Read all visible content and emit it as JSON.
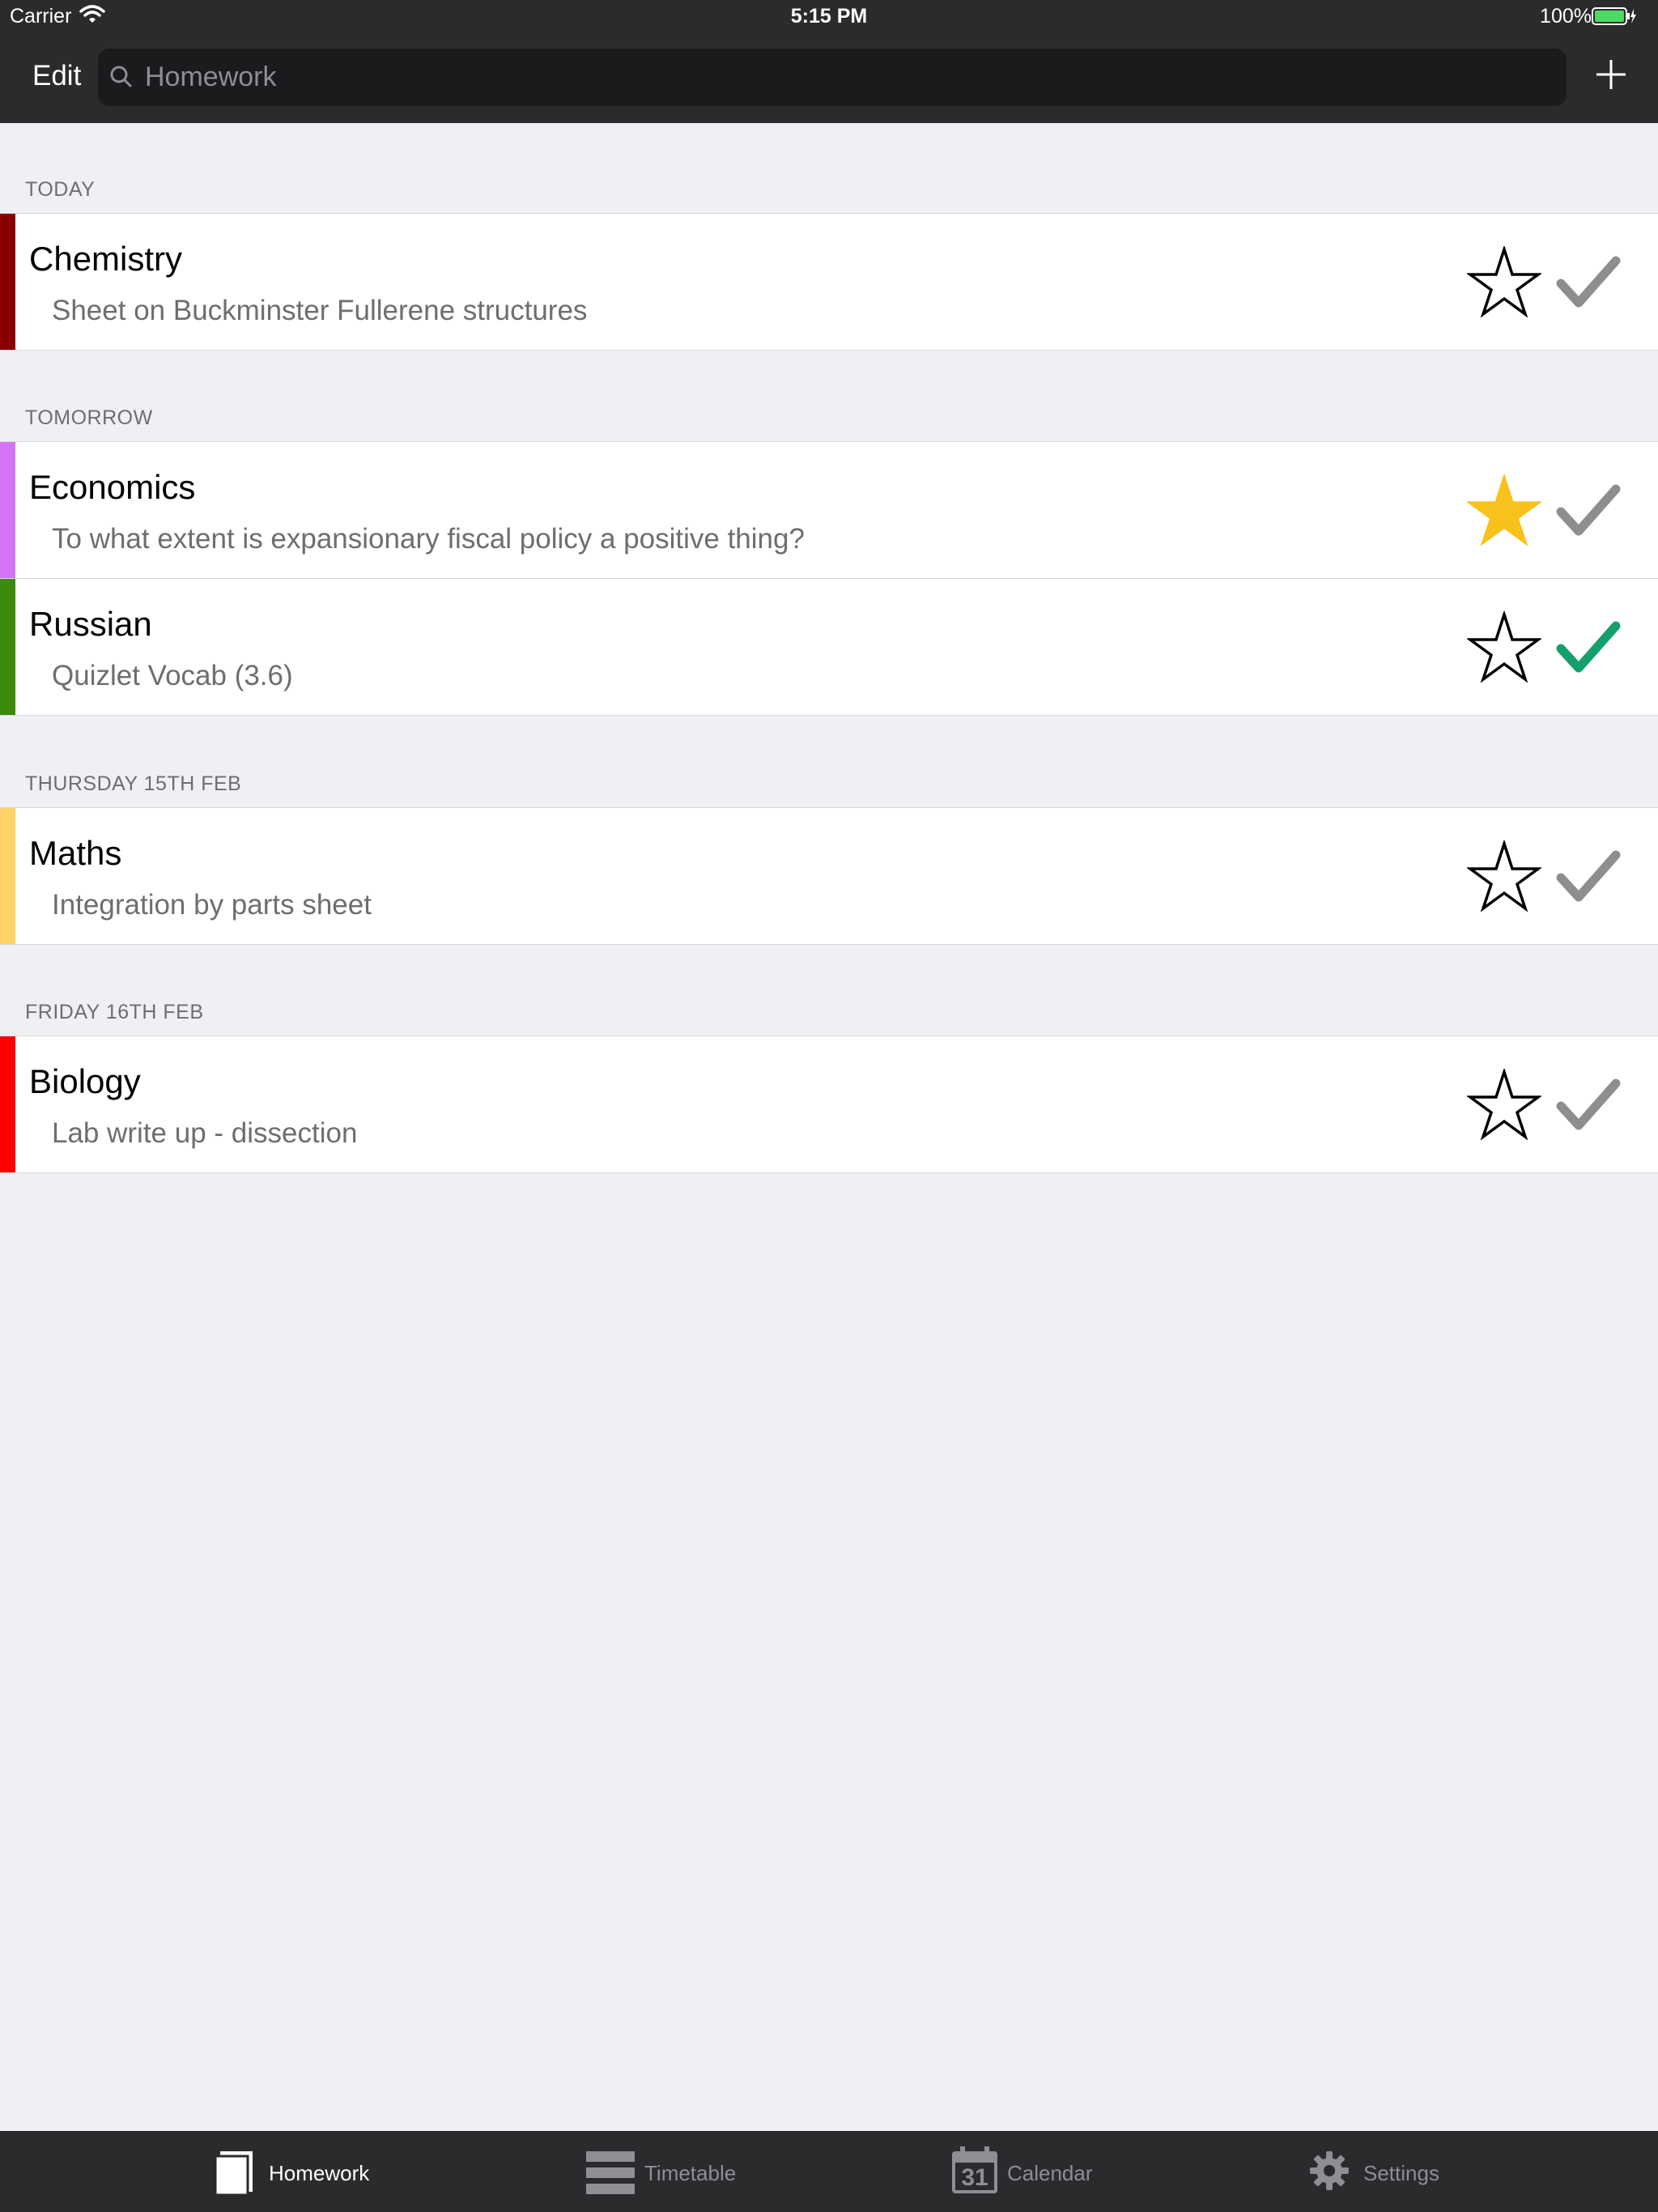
{
  "status_bar": {
    "carrier": "Carrier",
    "time": "5:15 PM",
    "battery": "100%"
  },
  "nav": {
    "edit_label": "Edit",
    "search_placeholder": "Homework"
  },
  "sections": [
    {
      "title": "TODAY",
      "items": [
        {
          "subject": "Chemistry",
          "description": "Sheet on Buckminster Fullerene structures",
          "color": "#8a0000",
          "starred": false,
          "done": false
        }
      ]
    },
    {
      "title": "TOMORROW",
      "items": [
        {
          "subject": "Economics",
          "description": "To what extent is expansionary fiscal policy a positive thing?",
          "color": "#d473f5",
          "starred": true,
          "done": false
        },
        {
          "subject": "Russian",
          "description": "Quizlet Vocab (3.6)",
          "color": "#3d8a0b",
          "starred": false,
          "done": true
        }
      ]
    },
    {
      "title": "THURSDAY 15TH FEB",
      "items": [
        {
          "subject": "Maths",
          "description": "Integration by parts sheet",
          "color": "#ffd266",
          "starred": false,
          "done": false
        }
      ]
    },
    {
      "title": "FRIDAY 16TH FEB",
      "items": [
        {
          "subject": "Biology",
          "description": "Lab write up - dissection",
          "color": "#ff0000",
          "starred": false,
          "done": false
        }
      ]
    }
  ],
  "tabs": [
    {
      "label": "Homework",
      "icon": "book-icon",
      "active": true
    },
    {
      "label": "Timetable",
      "icon": "timetable-icon",
      "active": false
    },
    {
      "label": "Calendar",
      "icon": "calendar-icon",
      "calendar_day": "31",
      "active": false
    },
    {
      "label": "Settings",
      "icon": "gear-icon",
      "active": false
    }
  ],
  "colors": {
    "star_active": "#f8c11c",
    "check_done": "#159f6b",
    "check_pending": "#8e8e8e",
    "tab_active": "#ffffff",
    "tab_inactive": "#8e8e93"
  }
}
